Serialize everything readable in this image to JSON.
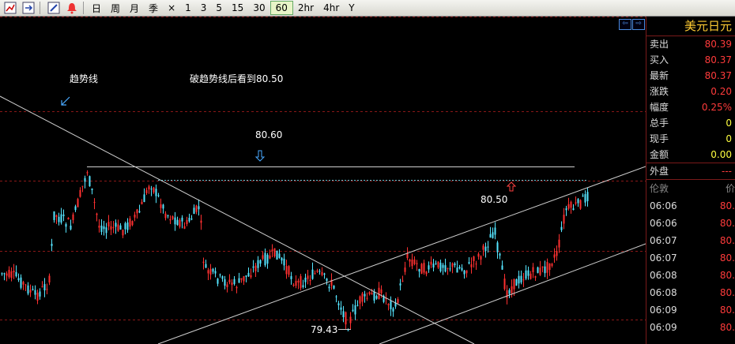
{
  "toolbar": {
    "periods": [
      "日",
      "周",
      "月",
      "季",
      "×",
      "1",
      "3",
      "5",
      "15",
      "30",
      "60",
      "2hr",
      "4hr",
      "Y"
    ],
    "active": "60"
  },
  "chart": {
    "annotations": {
      "trendline": "趋势线",
      "break_note": "破趋势线后看到80.50",
      "level_8060": "80.60",
      "level_8050": "80.50",
      "low": "79.43"
    },
    "colors": {
      "up": "#ff3030",
      "down": "#55e5ff",
      "trend": "#cfcfcf",
      "grid": "#8a1818"
    }
  },
  "panel": {
    "title": "美元日元",
    "quotes": [
      {
        "label": "卖出",
        "value": "80.39",
        "color": "red"
      },
      {
        "label": "买入",
        "value": "80.37",
        "color": "red"
      },
      {
        "label": "最新",
        "value": "80.37",
        "color": "red"
      },
      {
        "label": "涨跌",
        "value": "0.20",
        "color": "red"
      },
      {
        "label": "幅度",
        "value": "0.25%",
        "color": "red"
      },
      {
        "label": "总手",
        "value": "0",
        "color": "yel"
      },
      {
        "label": "现手",
        "value": "0",
        "color": "yel"
      },
      {
        "label": "金额",
        "value": "0.00",
        "color": "yel"
      },
      {
        "label": "外盘",
        "value": "---",
        "color": "red"
      }
    ],
    "ticks_header": {
      "time": "伦敦",
      "price": "价"
    },
    "ticks": [
      {
        "time": "06:06",
        "price": "80."
      },
      {
        "time": "06:06",
        "price": "80."
      },
      {
        "time": "06:07",
        "price": "80."
      },
      {
        "time": "06:07",
        "price": "80."
      },
      {
        "time": "06:08",
        "price": "80."
      },
      {
        "time": "06:08",
        "price": "80."
      },
      {
        "time": "06:09",
        "price": "80."
      },
      {
        "time": "06:09",
        "price": "80."
      }
    ]
  }
}
